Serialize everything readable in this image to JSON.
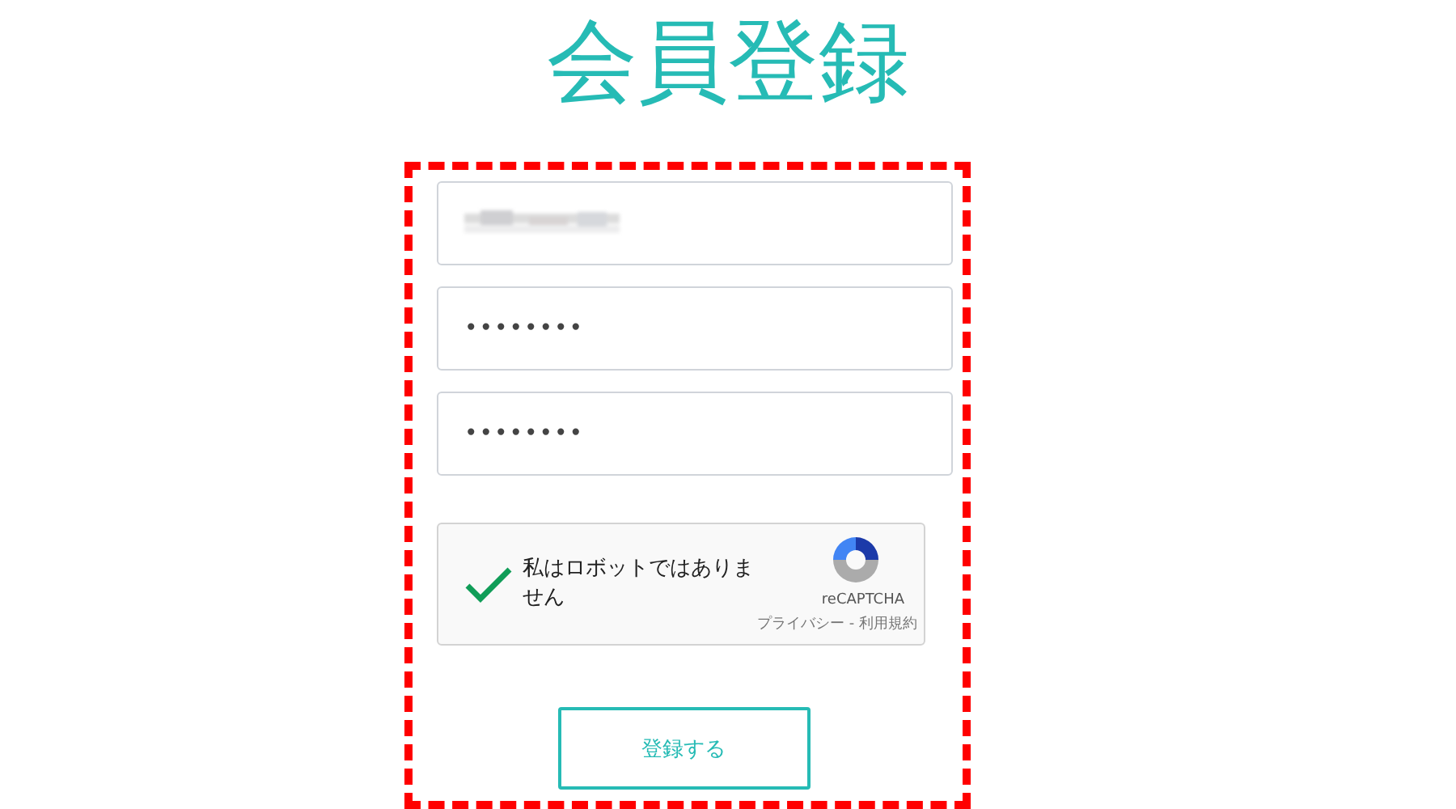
{
  "title": "会員登録",
  "fields": [
    {
      "kind": "redacted"
    },
    {
      "kind": "password",
      "value": "••••••••"
    },
    {
      "kind": "password",
      "value": "••••••••"
    }
  ],
  "captcha": {
    "checked": true,
    "label": "私はロボットではありません",
    "brand": "reCAPTCHA",
    "links": "プライバシー - 利用規約"
  },
  "submit": {
    "label": "登録する"
  }
}
